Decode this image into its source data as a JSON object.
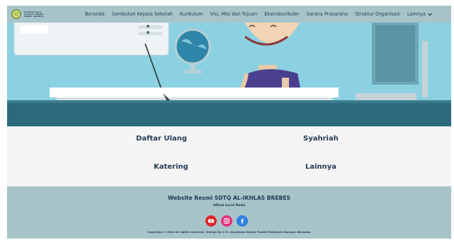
{
  "navbar": {
    "logo_lines": [
      "SD Tahfidzul Qur'an",
      "AL-IKHLAS - BREBES",
      "BREBES - INDONESIA"
    ],
    "menu": [
      {
        "label": "Beranda"
      },
      {
        "label": "Sambutan Kepala Sekolah"
      },
      {
        "label": "Kurikulum"
      },
      {
        "label": "Visi, Misi dan Tujuan"
      },
      {
        "label": "Ekstrakurikuler"
      },
      {
        "label": "Sarana Prasarana"
      },
      {
        "label": "Struktur Organisasi"
      },
      {
        "label": "Lainnya"
      }
    ]
  },
  "services": {
    "daftar_ulang": "Daftar Ulang",
    "syahriah": "Syahriah",
    "katering": "Katering",
    "lainnya": "Lainnya"
  },
  "footer": {
    "title": "Website Resmi SDTQ AL-IKHLAS BREBES",
    "subtitle": "Official Social Media",
    "socials": [
      "youtube-icon",
      "instagram-icon",
      "facebook-icon"
    ],
    "copyright": "Copyright © 2024 All rights reserved | Design By S.Tr. Akuntansi Sektor Publik-Politeknik Harapan Bersama"
  },
  "colors": {
    "navbar_bg": "#a7c4c9",
    "text_dark": "#243a55",
    "hero_sky": "#8cd1e2",
    "hero_floor": "#2b6a7c",
    "youtube": "#e0262d",
    "instagram": "#e2307a",
    "facebook": "#2f7fe0"
  }
}
